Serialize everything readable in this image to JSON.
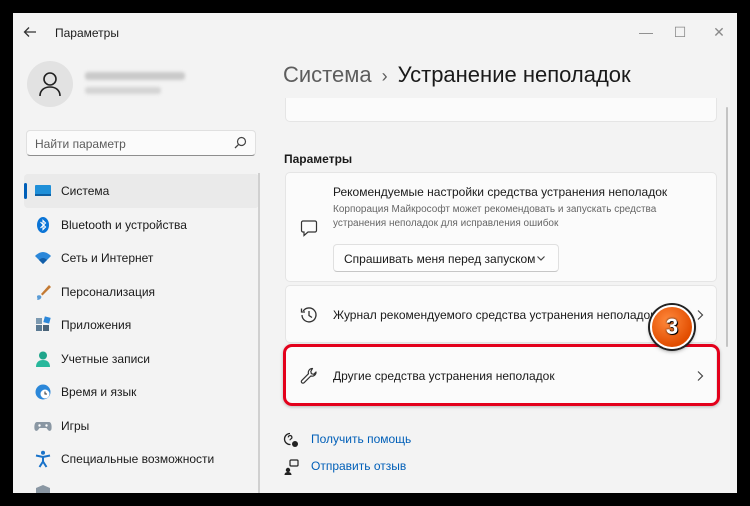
{
  "app": {
    "title": "Параметры"
  },
  "window_controls": {
    "minimize": "—",
    "maximize": "☐",
    "close": "✕"
  },
  "search": {
    "placeholder": "Найти параметр"
  },
  "nav": {
    "items": [
      {
        "label": "Система",
        "icon": "display-icon",
        "selected": true
      },
      {
        "label": "Bluetooth и устройства",
        "icon": "bluetooth-icon"
      },
      {
        "label": "Сеть и Интернет",
        "icon": "wifi-icon"
      },
      {
        "label": "Персонализация",
        "icon": "brush-icon"
      },
      {
        "label": "Приложения",
        "icon": "apps-icon"
      },
      {
        "label": "Учетные записи",
        "icon": "person-icon"
      },
      {
        "label": "Время и язык",
        "icon": "globe-clock-icon"
      },
      {
        "label": "Игры",
        "icon": "gamepad-icon"
      },
      {
        "label": "Специальные возможности",
        "icon": "accessibility-icon"
      }
    ]
  },
  "breadcrumb": {
    "parent": "Система",
    "separator": "›",
    "current": "Устранение неполадок"
  },
  "section": {
    "heading": "Параметры"
  },
  "recommended": {
    "title": "Рекомендуемые настройки средства устранения неполадок",
    "description": "Корпорация Майкрософт может рекомендовать и запускать средства устранения неполадок для исправления ошибок",
    "dropdown_value": "Спрашивать меня перед запуском"
  },
  "history": {
    "label": "Журнал рекомендуемого средства устранения неполадок"
  },
  "other": {
    "label": "Другие средства устранения неполадок"
  },
  "annotation": {
    "step": "3",
    "highlight_color": "#e3001b",
    "badge_color": "#f26a1b"
  },
  "links": {
    "help": "Получить помощь",
    "feedback": "Отправить отзыв"
  },
  "colors": {
    "accent": "#005fb8",
    "window_bg": "#f3f3f3",
    "card_bg": "#fbfbfb"
  }
}
